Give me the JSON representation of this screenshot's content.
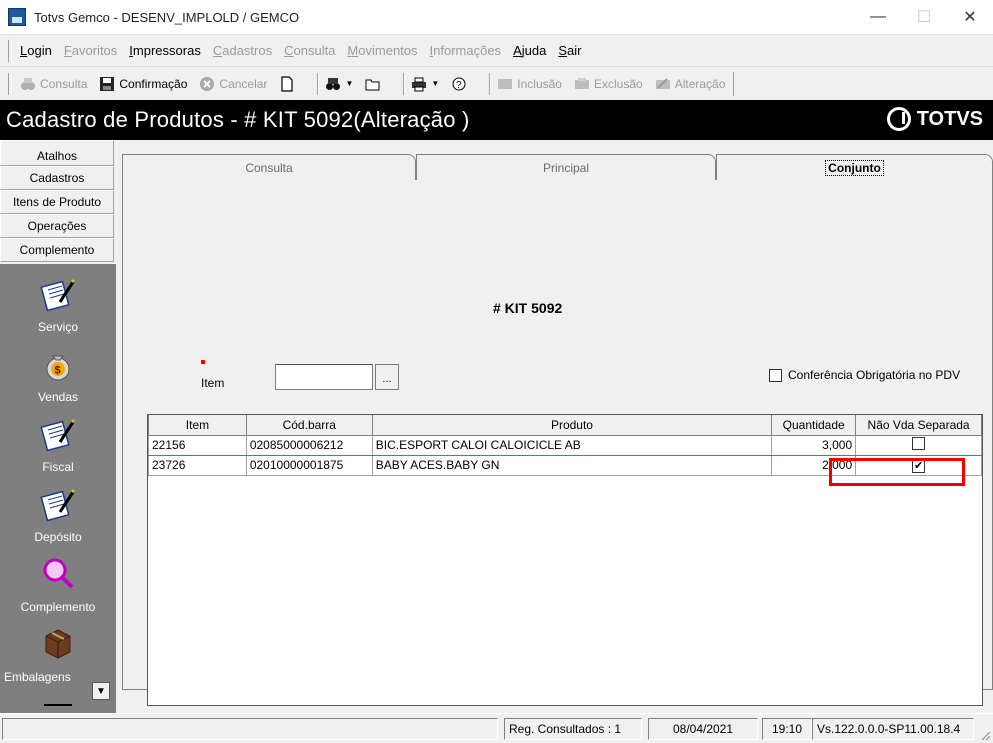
{
  "window": {
    "title": "Totvs Gemco - DESENV_IMPLOLD / GEMCO",
    "minimize": "—",
    "maximize": "☐",
    "close": "✕"
  },
  "menu": [
    {
      "label": "Login",
      "enabled": true
    },
    {
      "label": "Favoritos",
      "enabled": false
    },
    {
      "label": "Impressoras",
      "enabled": true
    },
    {
      "label": "Cadastros",
      "enabled": false
    },
    {
      "label": "Consulta",
      "enabled": false
    },
    {
      "label": "Movimentos",
      "enabled": false
    },
    {
      "label": "Informações",
      "enabled": false
    },
    {
      "label": "Ajuda",
      "enabled": true
    },
    {
      "label": "Sair",
      "enabled": true
    }
  ],
  "toolbar": {
    "consulta": "Consulta",
    "confirmacao": "Confirmação",
    "cancelar": "Cancelar",
    "inclusao": "Inclusão",
    "exclusao": "Exclusão",
    "alteracao": "Alteração"
  },
  "header": {
    "title": "Cadastro de Produtos  - # KIT 5092(Alteração )",
    "logo": "TOTVS"
  },
  "leftnav": {
    "tabs": [
      "Atalhos",
      "Cadastros",
      "Itens de Produto",
      "Operações",
      "Complemento"
    ],
    "entries": [
      {
        "label": "Serviço",
        "icon": "notepad-pen-icon"
      },
      {
        "label": "Vendas",
        "icon": "money-bag-icon"
      },
      {
        "label": "Fiscal",
        "icon": "notepad-pen-icon"
      },
      {
        "label": "Depósito",
        "icon": "notepad-pen-icon"
      },
      {
        "label": "Complemento",
        "icon": "magnifier-icon"
      },
      {
        "label": "Embalagens",
        "icon": "box-icon"
      }
    ]
  },
  "tabs": [
    {
      "label": "Consulta",
      "active": false
    },
    {
      "label": "Principal",
      "active": false
    },
    {
      "label": "Conjunto",
      "active": true
    }
  ],
  "form": {
    "kit_label": "# KIT 5092",
    "item_label": "Item",
    "item_value": "",
    "browse_button": "...",
    "pdv_label": "Conferência Obrigatória no PDV",
    "pdv_checked": false
  },
  "grid": {
    "columns": [
      "Item",
      "Cód.barra",
      "Produto",
      "Quantidade",
      "Não Vda Separada"
    ],
    "rows": [
      {
        "item": "22156",
        "barcode": "02085000006212",
        "product": "BIC.ESPORT CALOI CALOICICLE  AB",
        "qty": "3,000",
        "separate": false
      },
      {
        "item": "23726",
        "barcode": "02010000001875",
        "product": "BABY ACES.BABY  GN",
        "qty": "2,000",
        "separate": true
      }
    ]
  },
  "status": {
    "empty": "",
    "records": "Reg. Consultados : 1",
    "date": "08/04/2021",
    "time": "19:10",
    "version": "Vs.122.0.0.0-SP11.00.18.4"
  }
}
